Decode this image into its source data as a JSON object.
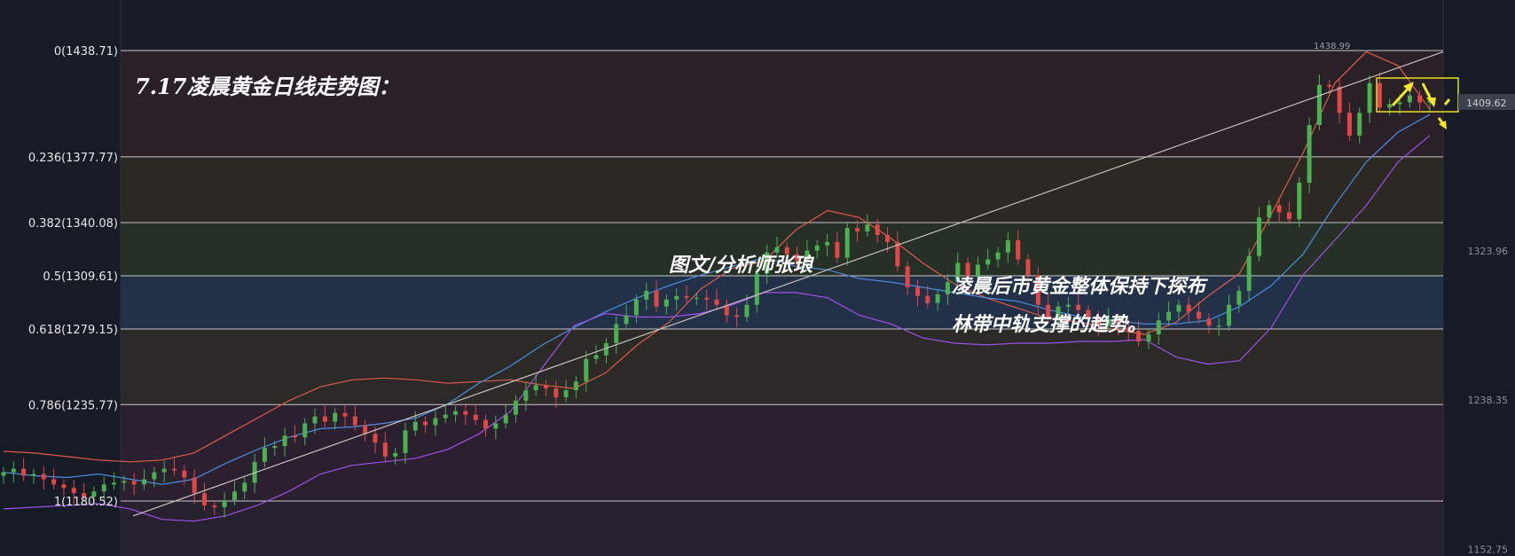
{
  "colors": {
    "background": "#171b26",
    "bull": "#4caf50",
    "bear": "#e04848",
    "upper_band": "#e05a4a",
    "middle_band": "#4a8ee0",
    "lower_band": "#a050e8",
    "trendline": "#c8c0bc",
    "highlight_box": "#e8e020"
  },
  "annotations": {
    "title": "7.17凌晨黄金日线走势图：",
    "watermark": "图文/分析师张琅",
    "comment_line1": "凌晨后市黄金整体保持下探布",
    "comment_line2": "林带中轨支撑的趋势。"
  },
  "current_price": "1409.62",
  "high_marker": "1438.99",
  "chart_data": {
    "type": "candlestick",
    "title": "7.17凌晨黄金日线走势图：",
    "fibonacci_levels": [
      {
        "label": "0(1438.71)",
        "ratio": 0,
        "price": 1438.71
      },
      {
        "label": "0.236(1377.77)",
        "ratio": 0.236,
        "price": 1377.77
      },
      {
        "label": "0.382(1340.08)",
        "ratio": 0.382,
        "price": 1340.08
      },
      {
        "label": "0.5(1309.61)",
        "ratio": 0.5,
        "price": 1309.61
      },
      {
        "label": "0.618(1279.15)",
        "ratio": 0.618,
        "price": 1279.15
      },
      {
        "label": "0.786(1235.77)",
        "ratio": 0.786,
        "price": 1235.77
      },
      {
        "label": "1(1180.52)",
        "ratio": 1,
        "price": 1180.52
      }
    ],
    "price_axis_ticks": [
      "1409.62",
      "1323.96",
      "1238.35",
      "1152.75"
    ],
    "ylim": [
      1148,
      1458
    ],
    "grid": true,
    "legend": "none",
    "series": [
      {
        "kind": "ohlc",
        "close": [
          1197,
          1199,
          1195,
          1196,
          1193,
          1190,
          1188,
          1185,
          1183,
          1186,
          1190,
          1191,
          1192,
          1190,
          1193,
          1197,
          1199,
          1198,
          1194,
          1185,
          1178,
          1177,
          1181,
          1186,
          1191,
          1203,
          1211,
          1212,
          1218,
          1217,
          1225,
          1229,
          1226,
          1231,
          1229,
          1224,
          1219,
          1214,
          1206,
          1208,
          1221,
          1226,
          1224,
          1228,
          1230,
          1232,
          1230,
          1227,
          1222,
          1225,
          1230,
          1238,
          1244,
          1247,
          1245,
          1240,
          1244,
          1249,
          1262,
          1264,
          1271,
          1282,
          1287,
          1296,
          1301,
          1292,
          1296,
          1298,
          1297,
          1297,
          1296,
          1293,
          1287,
          1286,
          1293,
          1311,
          1323,
          1326,
          1322,
          1318,
          1324,
          1327,
          1329,
          1320,
          1337,
          1335,
          1339,
          1333,
          1329,
          1315,
          1303,
          1298,
          1294,
          1299,
          1306,
          1317,
          1309,
          1316,
          1319,
          1323,
          1330,
          1319,
          1310,
          1293,
          1285,
          1292,
          1293,
          1290,
          1285,
          1281,
          1285,
          1280,
          1278,
          1272,
          1276,
          1284,
          1289,
          1293,
          1289,
          1285,
          1281,
          1281,
          1293,
          1301,
          1321,
          1343,
          1350,
          1346,
          1342,
          1363,
          1396,
          1419,
          1418,
          1403,
          1390,
          1403,
          1420,
          1406,
          1408,
          1409,
          1413,
          1409,
          1410
        ]
      },
      {
        "kind": "bollinger_upper",
        "name": "",
        "values": [
          1209,
          1208,
          1206,
          1204,
          1203,
          1204,
          1208,
          1218,
          1228,
          1238,
          1246,
          1250,
          1251,
          1250,
          1248,
          1249,
          1250,
          1247,
          1245,
          1254,
          1270,
          1283,
          1302,
          1314,
          1318,
          1336,
          1347,
          1343,
          1331,
          1317,
          1305,
          1297,
          1291,
          1285,
          1283,
          1279,
          1276,
          1283,
          1298,
          1311,
          1345,
          1380,
          1420,
          1438,
          1430,
          1405
        ]
      },
      {
        "kind": "bollinger_middle",
        "name": "",
        "values": [
          1197,
          1195,
          1194,
          1196,
          1193,
          1190,
          1193,
          1202,
          1210,
          1217,
          1222,
          1223,
          1225,
          1228,
          1236,
          1248,
          1258,
          1270,
          1280,
          1289,
          1297,
          1304,
          1310,
          1315,
          1320,
          1315,
          1313,
          1308,
          1306,
          1303,
          1300,
          1297,
          1295,
          1290,
          1286,
          1284,
          1282,
          1282,
          1284,
          1292,
          1304,
          1322,
          1350,
          1375,
          1392,
          1402
        ]
      },
      {
        "kind": "bollinger_lower",
        "name": "",
        "values": [
          1176,
          1177,
          1178,
          1179,
          1176,
          1170,
          1169,
          1172,
          1178,
          1186,
          1196,
          1201,
          1203,
          1205,
          1210,
          1219,
          1232,
          1257,
          1281,
          1288,
          1286,
          1286,
          1288,
          1293,
          1300,
          1300,
          1297,
          1287,
          1282,
          1274,
          1271,
          1270,
          1271,
          1271,
          1272,
          1272,
          1273,
          1263,
          1259,
          1261,
          1280,
          1310,
          1330,
          1350,
          1375,
          1390
        ]
      }
    ],
    "trendline": {
      "from": 1172,
      "to": 1438,
      "label": ""
    }
  }
}
